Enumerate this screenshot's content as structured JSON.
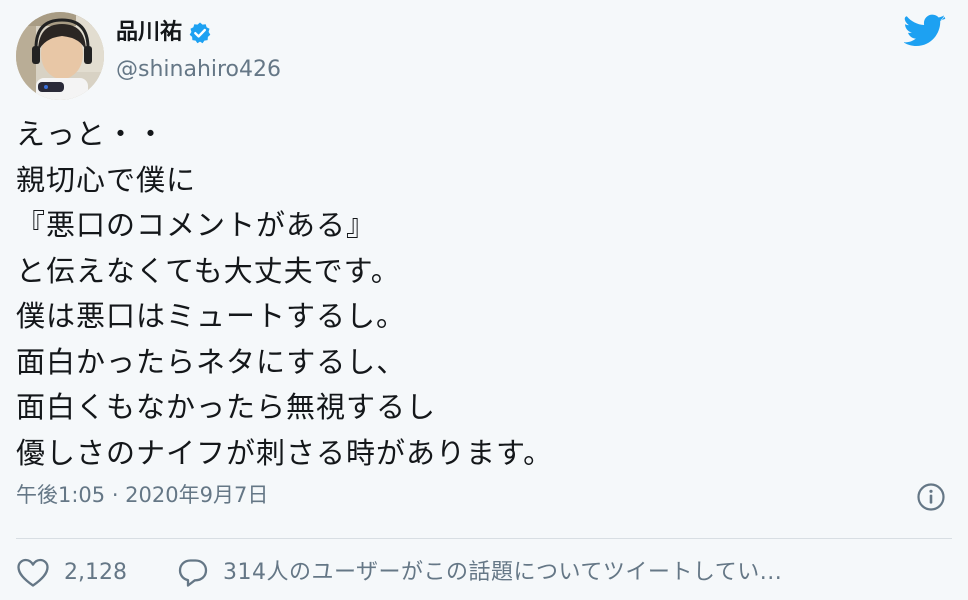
{
  "author": {
    "display_name": "品川祐",
    "handle": "@shinahiro426",
    "verified": true,
    "avatar_icon": "avatar-photo"
  },
  "tweet": {
    "lines": [
      "えっと・・",
      "親切心で僕に",
      "『悪口のコメントがある』",
      "と伝えなくても大丈夫です。",
      "僕は悪口はミュートするし。",
      "面白かったらネタにするし、",
      "面白くもなかったら無視するし",
      "優しさのナイフが刺さる時があります。"
    ],
    "timestamp": "午後1:05 · 2020年9月7日"
  },
  "actions": {
    "like_count": "2,128",
    "conversation_text": "314人のユーザーがこの話題についてツイートしてい..."
  },
  "icons": {
    "logo": "twitter-bird-icon",
    "verified": "verified-badge-icon",
    "info": "info-icon",
    "like": "heart-icon",
    "conversation": "chat-bubble-icon"
  },
  "colors": {
    "background": "#f5f8fa",
    "text": "#14171a",
    "secondary": "#657786",
    "twitter_blue": "#1da1f2"
  }
}
